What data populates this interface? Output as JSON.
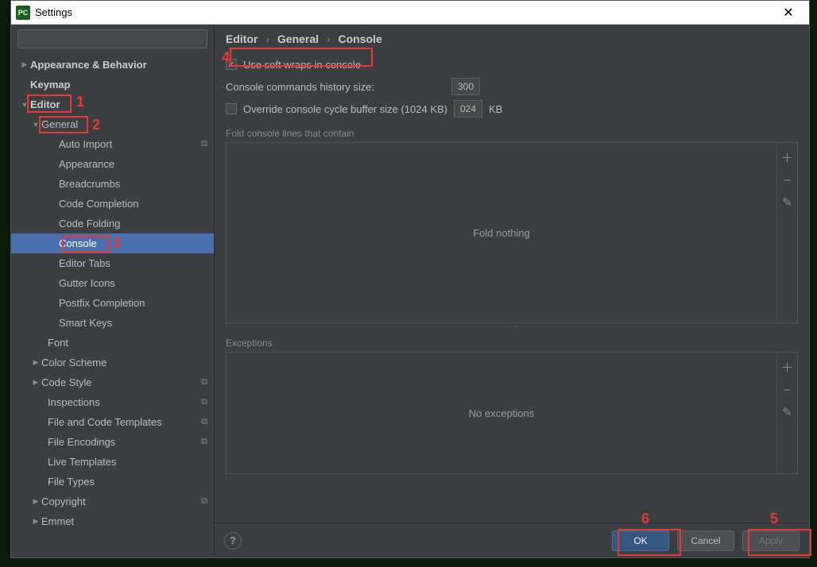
{
  "window": {
    "title": "Settings"
  },
  "search": {
    "placeholder": ""
  },
  "tree": {
    "appearance": "Appearance & Behavior",
    "keymap": "Keymap",
    "editor": "Editor",
    "general": "General",
    "auto_import": "Auto Import",
    "appearance2": "Appearance",
    "breadcrumbs": "Breadcrumbs",
    "code_completion": "Code Completion",
    "code_folding": "Code Folding",
    "console": "Console",
    "editor_tabs": "Editor Tabs",
    "gutter_icons": "Gutter Icons",
    "postfix_completion": "Postfix Completion",
    "smart_keys": "Smart Keys",
    "font": "Font",
    "color_scheme": "Color Scheme",
    "code_style": "Code Style",
    "inspections": "Inspections",
    "file_code_templates": "File and Code Templates",
    "file_encodings": "File Encodings",
    "live_templates": "Live Templates",
    "file_types": "File Types",
    "copyright": "Copyright",
    "emmet": "Emmet"
  },
  "breadcrumb": {
    "p0": "Editor",
    "p1": "General",
    "p2": "Console"
  },
  "settings": {
    "use_soft_wraps": "Use soft wraps in console",
    "history_label": "Console commands history size:",
    "history_value": "300",
    "override_label": "Override console cycle buffer size (1024 KB)",
    "override_value": "024",
    "override_unit": "KB",
    "fold_section": "Fold console lines that contain",
    "fold_placeholder": "Fold nothing",
    "exceptions_section": "Exceptions",
    "exceptions_placeholder": "No exceptions"
  },
  "buttons": {
    "ok": "OK",
    "cancel": "Cancel",
    "apply": "Apply"
  },
  "annotations": {
    "a1": "1",
    "a2": "2",
    "a3": "3",
    "a4": "4",
    "a5": "5",
    "a6": "6"
  }
}
